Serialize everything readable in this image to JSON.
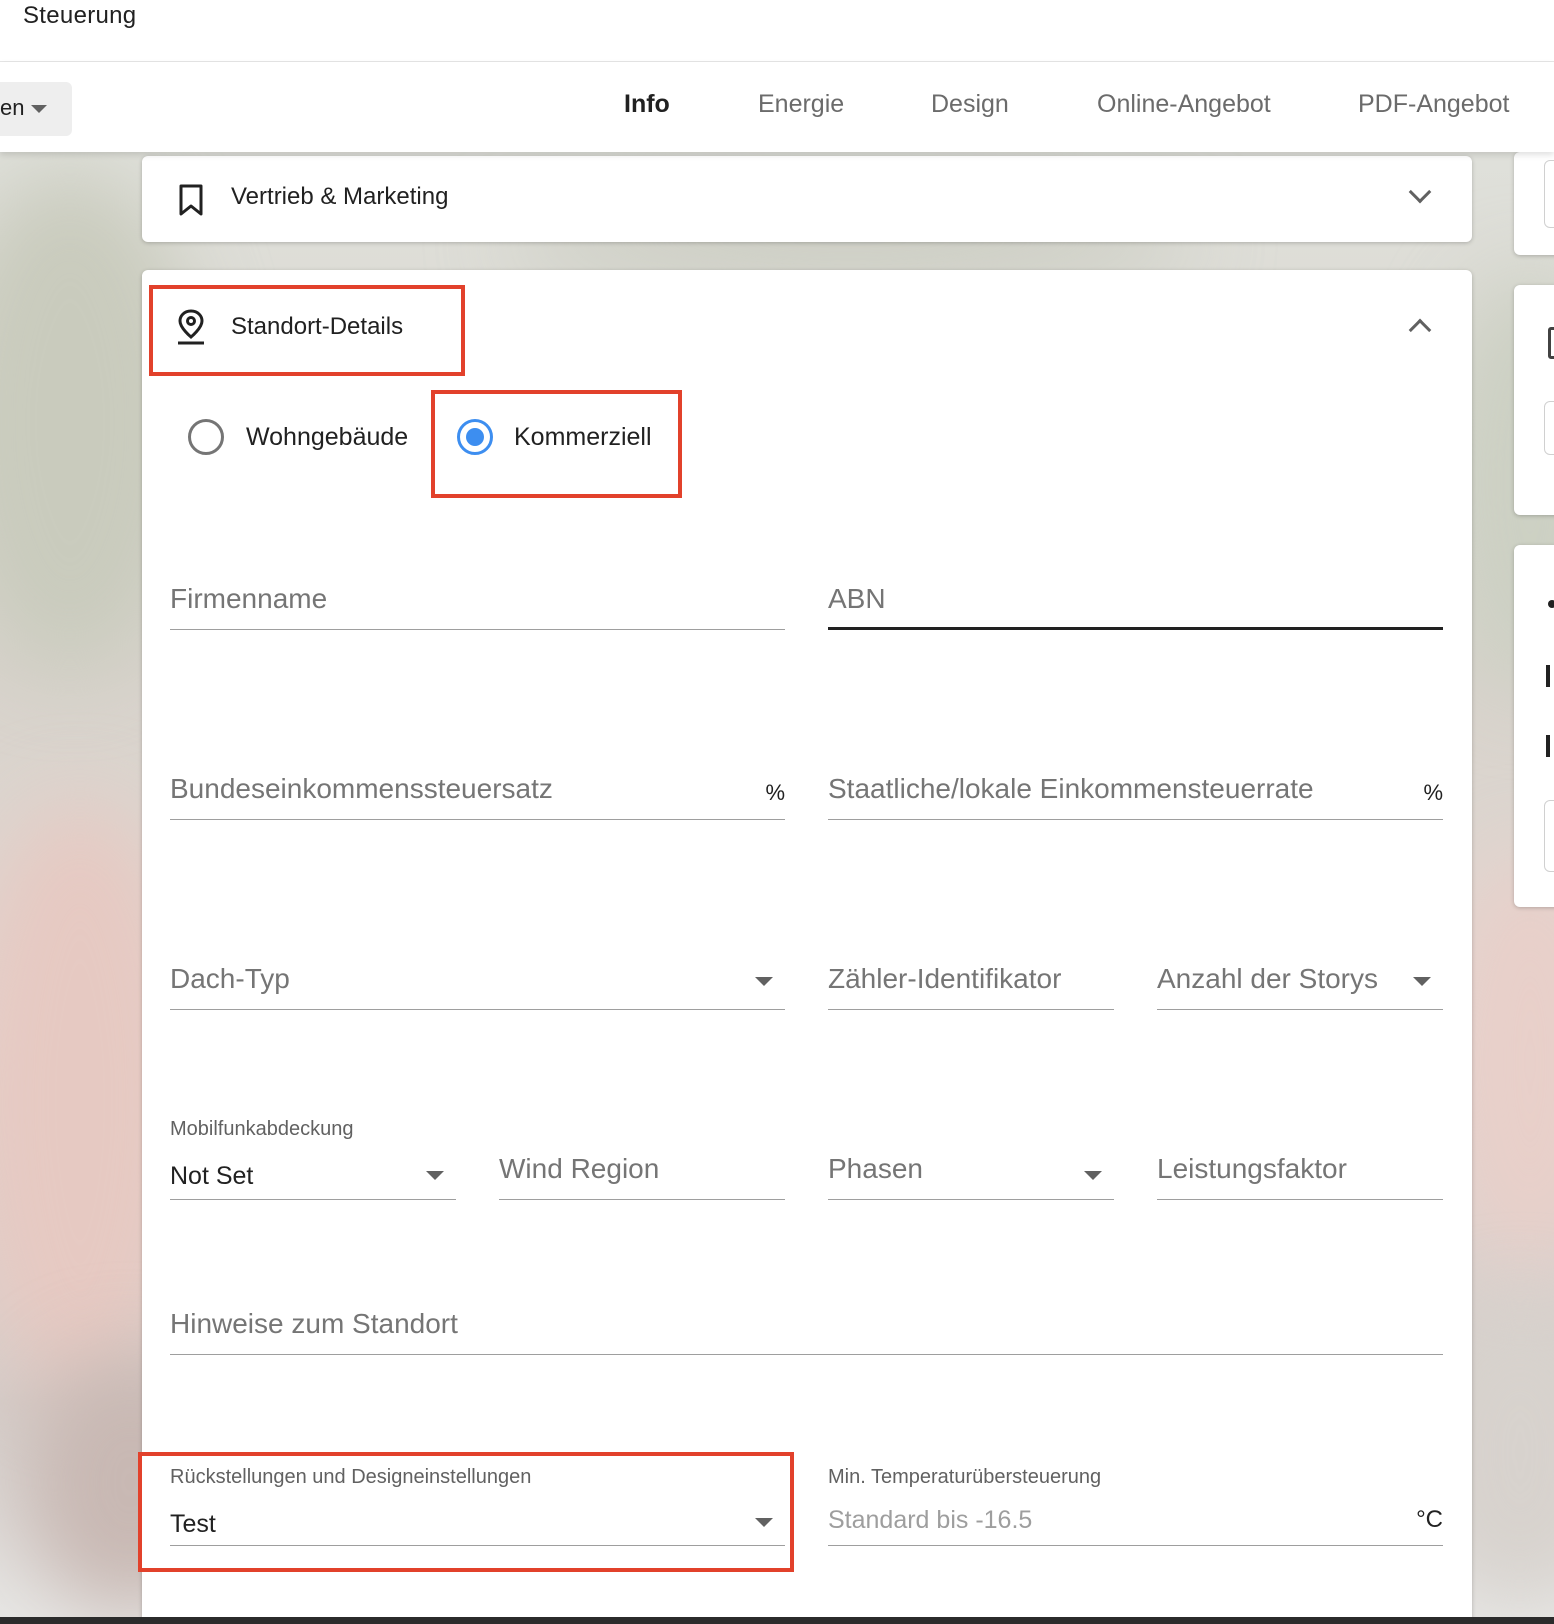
{
  "app": {
    "title": "Steuerung"
  },
  "nav": {
    "selector_text": "en",
    "tabs": [
      {
        "label": "Info",
        "active": true
      },
      {
        "label": "Energie",
        "active": false
      },
      {
        "label": "Design",
        "active": false
      },
      {
        "label": "Online-Angebot",
        "active": false
      },
      {
        "label": "PDF-Angebot",
        "active": false
      }
    ]
  },
  "sales_section": {
    "label": "Vertrieb & Marketing",
    "icon": "bookmark-icon",
    "expanded": false
  },
  "site_section": {
    "label": "Standort-Details",
    "icon": "location-pin-icon",
    "expanded": true,
    "property_type": {
      "options": [
        "Wohngebäude",
        "Kommerziell"
      ],
      "selected": "Kommerziell"
    },
    "fields": {
      "company_name": {
        "placeholder": "Firmenname"
      },
      "abn": {
        "placeholder": "ABN"
      },
      "federal_tax": {
        "placeholder": "Bundeseinkommenssteuersatz",
        "unit": "%"
      },
      "state_tax": {
        "placeholder": "Staatliche/lokale Einkommensteuerrate",
        "unit": "%"
      },
      "roof_type": {
        "placeholder": "Dach-Typ"
      },
      "meter_id": {
        "placeholder": "Zähler-Identifikator"
      },
      "stories": {
        "placeholder": "Anzahl der Storys"
      },
      "cell_coverage": {
        "label": "Mobilfunkabdeckung",
        "value": "Not Set"
      },
      "wind_region": {
        "placeholder": "Wind Region"
      },
      "phases": {
        "placeholder": "Phasen"
      },
      "power_factor": {
        "placeholder": "Leistungsfaktor"
      },
      "site_notes": {
        "placeholder": "Hinweise zum Standort"
      },
      "setbacks": {
        "label": "Rückstellungen und Designeinstellungen",
        "value": "Test"
      },
      "min_temp": {
        "label": "Min. Temperaturübersteuerung",
        "placeholder": "Standard bis -16.5",
        "unit": "°C"
      }
    }
  },
  "colors": {
    "accent": "#3d8ef0",
    "highlight": "#e2412b"
  }
}
